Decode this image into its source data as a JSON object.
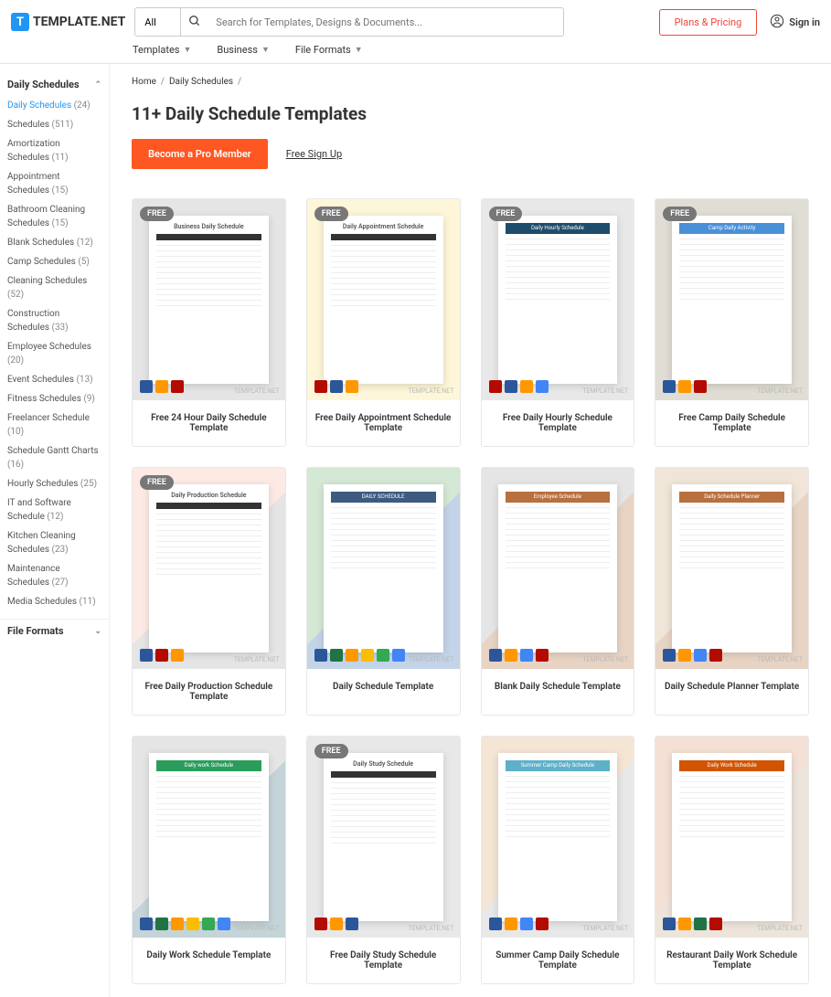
{
  "logo": {
    "icon": "T",
    "text": "TEMPLATE.NET"
  },
  "search": {
    "cat": "All",
    "placeholder": "Search for Templates, Designs & Documents..."
  },
  "header": {
    "plans": "Plans & Pricing",
    "signin": "Sign in"
  },
  "nav": [
    {
      "l": "Templates"
    },
    {
      "l": "Business"
    },
    {
      "l": "File Formats"
    }
  ],
  "breadcrumb": {
    "home": "Home",
    "current": "Daily Schedules"
  },
  "title": "11+ Daily Schedule Templates",
  "cta": {
    "pro": "Become a Pro Member",
    "free": "Free Sign Up"
  },
  "sidebar": {
    "header1": "Daily Schedules",
    "header2": "File Formats",
    "items": [
      {
        "l": "Daily Schedules",
        "c": "(24)",
        "active": true
      },
      {
        "l": "Schedules",
        "c": "(511)"
      },
      {
        "l": "Amortization Schedules",
        "c": "(11)"
      },
      {
        "l": "Appointment Schedules",
        "c": "(15)"
      },
      {
        "l": "Bathroom Cleaning Schedules",
        "c": "(15)"
      },
      {
        "l": "Blank Schedules",
        "c": "(12)"
      },
      {
        "l": "Camp Schedules",
        "c": "(5)"
      },
      {
        "l": "Cleaning Schedules",
        "c": "(52)"
      },
      {
        "l": "Construction Schedules",
        "c": "(33)"
      },
      {
        "l": "Employee Schedules",
        "c": "(20)"
      },
      {
        "l": "Event Schedules",
        "c": "(13)"
      },
      {
        "l": "Fitness Schedules",
        "c": "(9)"
      },
      {
        "l": "Freelancer Schedule",
        "c": "(10)"
      },
      {
        "l": "Schedule Gantt Charts",
        "c": "(16)"
      },
      {
        "l": "Hourly Schedules",
        "c": "(25)"
      },
      {
        "l": "IT and Software Schedule",
        "c": "(12)"
      },
      {
        "l": "Kitchen Cleaning Schedules",
        "c": "(23)"
      },
      {
        "l": "Maintenance Schedules",
        "c": "(27)"
      },
      {
        "l": "Media Schedules",
        "c": "(11)"
      }
    ]
  },
  "badge": "FREE",
  "watermark": "TEMPLATE.NET",
  "cards": [
    {
      "title": "Free 24 Hour Daily Schedule Template",
      "free": true,
      "bg": "bg1",
      "preview": "Business Daily Schedule",
      "icons": [
        "w",
        "n",
        "p"
      ]
    },
    {
      "title": "Free Daily Appointment Schedule Template",
      "free": true,
      "bg": "bg2",
      "preview": "Daily Appointment Schedule",
      "icons": [
        "p",
        "w",
        "n"
      ]
    },
    {
      "title": "Free Daily Hourly Schedule Template",
      "free": true,
      "bg": "bg3",
      "preview": "Daily Hourly Schedule",
      "icons": [
        "p",
        "w",
        "n",
        "g"
      ],
      "header": "#1e4d6b"
    },
    {
      "title": "Free Camp Daily Schedule Template",
      "free": true,
      "bg": "bg4",
      "preview": "Camp Daily Activity",
      "icons": [
        "w",
        "n",
        "p"
      ],
      "header": "#4a90d9"
    },
    {
      "title": "Free Daily Production Schedule Template",
      "free": true,
      "bg": "bg5",
      "preview": "Daily Production Schedule",
      "icons": [
        "w",
        "p",
        "n"
      ]
    },
    {
      "title": "Daily Schedule Template",
      "free": false,
      "bg": "bg6",
      "preview": "DAILY SCHEDULE",
      "icons": [
        "w",
        "x",
        "n",
        "gslide",
        "gs",
        "g"
      ],
      "header": "#3d5a80"
    },
    {
      "title": "Blank Daily Schedule Template",
      "free": false,
      "bg": "bg7",
      "preview": "Employee Schedule",
      "icons": [
        "w",
        "n",
        "g",
        "p"
      ],
      "header": "#b8703e"
    },
    {
      "title": "Daily Schedule Planner Template",
      "free": false,
      "bg": "bg8",
      "preview": "Daily Schedule Planner",
      "icons": [
        "w",
        "n",
        "g",
        "p"
      ],
      "header": "#b8703e"
    },
    {
      "title": "Daily Work Schedule Template",
      "free": false,
      "bg": "bg9",
      "preview": "Daily work Schedule",
      "icons": [
        "w",
        "x",
        "n",
        "gslide",
        "gs",
        "g"
      ],
      "header": "#2a9d5c"
    },
    {
      "title": "Free Daily Study Schedule Template",
      "free": true,
      "bg": "bg10",
      "preview": "Daily Study Schedule",
      "icons": [
        "p",
        "n",
        "w"
      ]
    },
    {
      "title": "Summer Camp Daily Schedule Template",
      "free": false,
      "bg": "bg11",
      "preview": "Summer Camp Daily Schedule",
      "icons": [
        "w",
        "n",
        "g",
        "p"
      ],
      "header": "#5eb0c9"
    },
    {
      "title": "Restaurant Daily Work Schedule Template",
      "free": false,
      "bg": "bg12",
      "preview": "Daily Work Schedule",
      "icons": [
        "w",
        "n",
        "x",
        "p"
      ],
      "header": "#d35400"
    }
  ]
}
